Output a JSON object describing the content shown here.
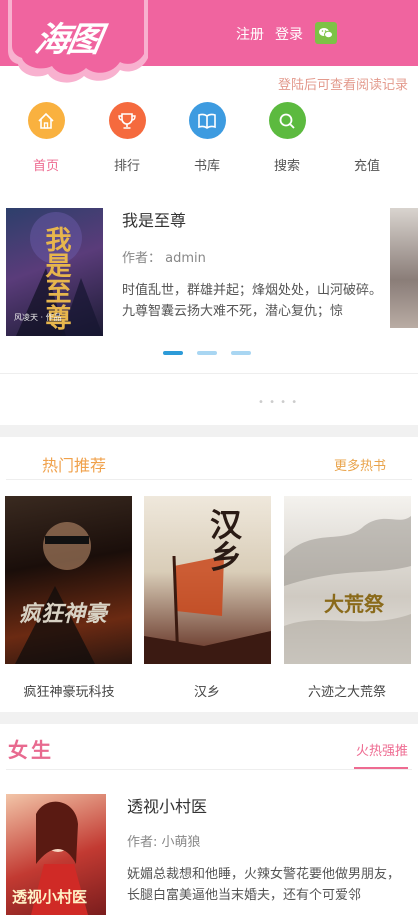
{
  "header": {
    "logo": "海图",
    "register": "注册",
    "login": "登录",
    "wechat_icon": "wechat-icon",
    "bg_color": "#f0649f"
  },
  "login_tip": "登陆后可查看阅读记录",
  "nav": [
    {
      "label": "首页",
      "icon": "home-icon",
      "color": "#f9b13f",
      "active": true
    },
    {
      "label": "排行",
      "icon": "trophy-icon",
      "color": "#f56a3e"
    },
    {
      "label": "书库",
      "icon": "book-icon",
      "color": "#3d9be0"
    },
    {
      "label": "搜索",
      "icon": "search-icon",
      "color": "#5cba3f"
    },
    {
      "label": "充值",
      "icon": "recharge-icon"
    }
  ],
  "carousel": {
    "title": "我是至尊",
    "author": "作者： admin",
    "description": "时值乱世，群雄并起；烽烟处处，山河破碎。九尊智囊云扬大难不死，潜心复仇；惊",
    "cover_text": "我是至尊",
    "cover_subtext": "风凌天 · 作品",
    "active_slide": 1,
    "slide_count": 3
  },
  "hot": {
    "title": "热门推荐",
    "more": "更多热书",
    "books": [
      {
        "name": "疯狂神豪玩科技",
        "cover_text": "疯狂神豪"
      },
      {
        "name": "汉乡",
        "cover_text": "汉乡"
      },
      {
        "name": "六迹之大荒祭",
        "cover_text": "大荒祭"
      }
    ]
  },
  "female": {
    "title": "女生",
    "tab": "火热强推",
    "book": {
      "title": "透视小村医",
      "author": "作者: 小萌狼",
      "description": "妩媚总裁想和他睡，火辣女警花要他做男朋友，长腿白富美逼他当末婚夫，还有个可爱邻",
      "cover_text": "透视小村医"
    }
  }
}
